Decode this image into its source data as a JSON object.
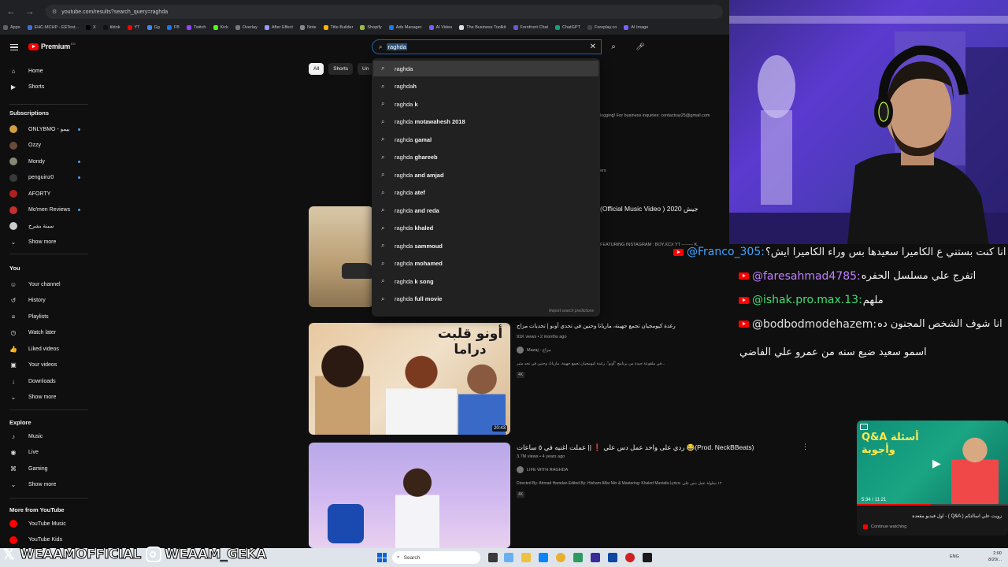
{
  "browser": {
    "url": "youtube.com/results?search_query=raghda",
    "bookmarks": [
      {
        "label": "Apps",
        "color": "#5f6368"
      },
      {
        "label": "EHC-MCHP - EETest...",
        "color": "#3c6fd8"
      },
      {
        "label": "X",
        "color": "#000000"
      },
      {
        "label": "tiktok",
        "color": "#111111"
      },
      {
        "label": "YT",
        "color": "#ff0000"
      },
      {
        "label": "Gg",
        "color": "#4285f4"
      },
      {
        "label": "FB",
        "color": "#1877f2"
      },
      {
        "label": "Twitch",
        "color": "#9146ff"
      },
      {
        "label": "Kick",
        "color": "#53fc18"
      },
      {
        "label": "Overlay",
        "color": "#777777"
      },
      {
        "label": "After Effect",
        "color": "#9999ff"
      },
      {
        "label": "Note",
        "color": "#888888"
      },
      {
        "label": "Title Builder",
        "color": "#ffb400"
      },
      {
        "label": "Shopify",
        "color": "#95bf47"
      },
      {
        "label": "Ads Manager",
        "color": "#1877f2"
      },
      {
        "label": "AI Video",
        "color": "#7a5cff"
      },
      {
        "label": "The Business Toolkit",
        "color": "#dddddd"
      },
      {
        "label": "Fornfront Chat",
        "color": "#6a5acd"
      },
      {
        "label": "ChatGPT",
        "color": "#10a37f"
      },
      {
        "label": "Foreplay.co",
        "color": "#444444"
      },
      {
        "label": "AI Image",
        "color": "#7b61ff"
      }
    ]
  },
  "youtube": {
    "logo_text": "Premium",
    "logo_sup": "EG",
    "search_value": "raghda",
    "chips": [
      "All",
      "Shorts",
      "Un"
    ],
    "sidebar": {
      "top": [
        {
          "label": "Home",
          "icon": "home-icon",
          "glyph": "⌂"
        },
        {
          "label": "Shorts",
          "icon": "shorts-icon",
          "glyph": "▶"
        }
      ],
      "subscriptions_header": "Subscriptions",
      "subscriptions": [
        {
          "label": "ONLYBMO - بيمو",
          "color": "#cfa040",
          "live": true
        },
        {
          "label": "Ozzy",
          "color": "#6b4a3a",
          "live": false
        },
        {
          "label": "Mondy",
          "color": "#888877",
          "live": true
        },
        {
          "label": "penguinz0",
          "color": "#3a3a3a",
          "live": true
        },
        {
          "label": "AFORTY",
          "color": "#b02020",
          "live": false
        },
        {
          "label": "Mo'men Reviews",
          "color": "#c03030",
          "live": true
        },
        {
          "label": "سبنة بشرح",
          "color": "#cccccc",
          "live": false
        }
      ],
      "show_more": "Show more",
      "you_header": "You",
      "you": [
        {
          "label": "Your channel",
          "icon": "your-channel-icon",
          "glyph": "☺"
        },
        {
          "label": "History",
          "icon": "history-icon",
          "glyph": "↺"
        },
        {
          "label": "Playlists",
          "icon": "playlists-icon",
          "glyph": "≡"
        },
        {
          "label": "Watch later",
          "icon": "watch-later-icon",
          "glyph": "◷"
        },
        {
          "label": "Liked videos",
          "icon": "liked-videos-icon",
          "glyph": "👍"
        },
        {
          "label": "Your videos",
          "icon": "your-videos-icon",
          "glyph": "▣"
        },
        {
          "label": "Downloads",
          "icon": "downloads-icon",
          "glyph": "↓"
        }
      ],
      "explore_header": "Explore",
      "explore": [
        {
          "label": "Music",
          "icon": "music-icon",
          "glyph": "♪"
        },
        {
          "label": "Live",
          "icon": "live-icon",
          "glyph": "◉"
        },
        {
          "label": "Gaming",
          "icon": "gaming-icon",
          "glyph": "⌘"
        }
      ],
      "more_header": "More from YouTube",
      "more": [
        {
          "label": "YouTube Music",
          "color": "#ff0000"
        },
        {
          "label": "YouTube Kids",
          "color": "#ff0000"
        }
      ]
    },
    "suggestions": [
      {
        "bold": "raghda",
        "rest": ""
      },
      {
        "bold": "raghda",
        "rest": "h"
      },
      {
        "bold": "raghda",
        "rest": " k"
      },
      {
        "bold": "raghda",
        "rest": " motawahesh 2018"
      },
      {
        "bold": "raghda",
        "rest": " gamal"
      },
      {
        "bold": "raghda",
        "rest": " ghareeb"
      },
      {
        "bold": "raghda",
        "rest": " and amjad"
      },
      {
        "bold": "raghda",
        "rest": " atef"
      },
      {
        "bold": "raghda",
        "rest": " and reda"
      },
      {
        "bold": "raghda",
        "rest": " khaled"
      },
      {
        "bold": "raghda",
        "rest": " sammoud"
      },
      {
        "bold": "raghda",
        "rest": " mohamed"
      },
      {
        "bold": "raghda",
        "rest": " k song"
      },
      {
        "bold": "raghda",
        "rest": " full movie"
      }
    ],
    "report_text": "Report search predictions",
    "results": {
      "r0_desc": "logging! For business inquiries: contactray25@gmail.com",
      "r0_meta": "ers",
      "r1_title": "(Official Music Video ) 2020 جيش",
      "r1_desc": "FEATURING INSTAGRAM : BOY.XCX YT -------- K.",
      "r2_title": "رغدة كيومجيان تجمع جهينة، ماريانا وحنين في تحدي أونو | تحديات مزاج",
      "r2_meta": "91K views • 2 months ago",
      "r2_channel": "Mazaj - مزاج",
      "r2_desc": "في ملقوعة جيدة من برنامج \"أونو\"، رغدة كيومجيان تجمع جهينة، ماريانا، وحنين في تحد مثير...",
      "r2_duration": "20:43",
      "r2_thumb_text": "أونو قلبت دراما",
      "r3_title": "ردي على واحد عمل دس علي ❗ || عملت اغنيه في ٥ ساعات 😂(Prod. NeckBBeats)",
      "r3_meta": "3.7M views • 4 years ago",
      "r3_channel": "LIFE WITH RAGHDA",
      "r3_desc": "Directed By: Ahmad Hamdan Edited By: Hisham Alfar Mix & Mastering: Khaled Mustafa Lyrics: ١٢ سلولة عمل دس علي",
      "badge": "4K"
    }
  },
  "chat": {
    "messages": [
      {
        "user": "@Franco_305:",
        "color": "#3ea6ff",
        "text": "انا كنت بستني ع الكاميرا سعيدها بس وراء الكاميرا ايش؟"
      },
      {
        "user": "@faresahmad4785:",
        "color": "#c080ff",
        "text": "اتفرج علي مسلسل الحفره"
      },
      {
        "user": "@ishak.pro.max.13:",
        "color": "#40e070",
        "text": "ملهم"
      },
      {
        "user": "@bodbodmodehazem:",
        "color": "#e0e0e0",
        "text": "انا شوف الشخص المجنون ده"
      }
    ],
    "continuation": "اسمو سعيد ضيع سنه من عمرو علي الفاضي"
  },
  "miniplayer": {
    "time": "5:34 / 11:21",
    "progress": 0.49,
    "title": "اول فيديو مقعدة - ( Q&A ) زويت علي اسالتكم",
    "thumb_text": "Q&A أسئلة وأجوبة",
    "sub": "Continue watching"
  },
  "overlay": {
    "x_handle": "WEAAMOFFICIAL",
    "ig_handle": "WEAAM_GEKA"
  },
  "taskbar": {
    "search_label": "Search",
    "lang": "ENG",
    "time": "2:00",
    "date": "8/20/..."
  }
}
